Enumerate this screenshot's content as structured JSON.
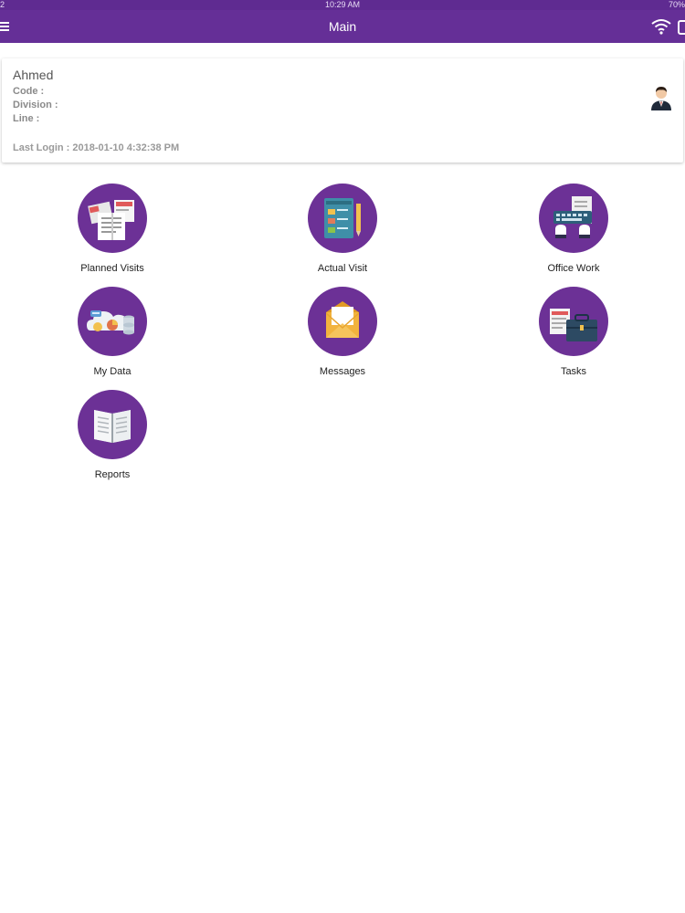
{
  "status_bar": {
    "left": "2",
    "time": "10:29 AM",
    "battery": "70%"
  },
  "nav": {
    "title": "Main"
  },
  "profile": {
    "name": "Ahmed",
    "code_label": "Code :",
    "division_label": "Division :",
    "line_label": "Line :",
    "last_login": "Last Login : 2018-01-10 4:32:38 PM"
  },
  "tiles": [
    {
      "label": "Planned Visits",
      "icon": "planned-visits-icon"
    },
    {
      "label": "Actual Visit",
      "icon": "actual-visit-icon"
    },
    {
      "label": "Office Work",
      "icon": "office-work-icon"
    },
    {
      "label": "My Data",
      "icon": "my-data-icon"
    },
    {
      "label": "Messages",
      "icon": "messages-icon"
    },
    {
      "label": "Tasks",
      "icon": "tasks-icon"
    },
    {
      "label": "Reports",
      "icon": "reports-icon"
    }
  ],
  "colors": {
    "primary": "#652f97",
    "tile_circle": "#6c3196"
  }
}
